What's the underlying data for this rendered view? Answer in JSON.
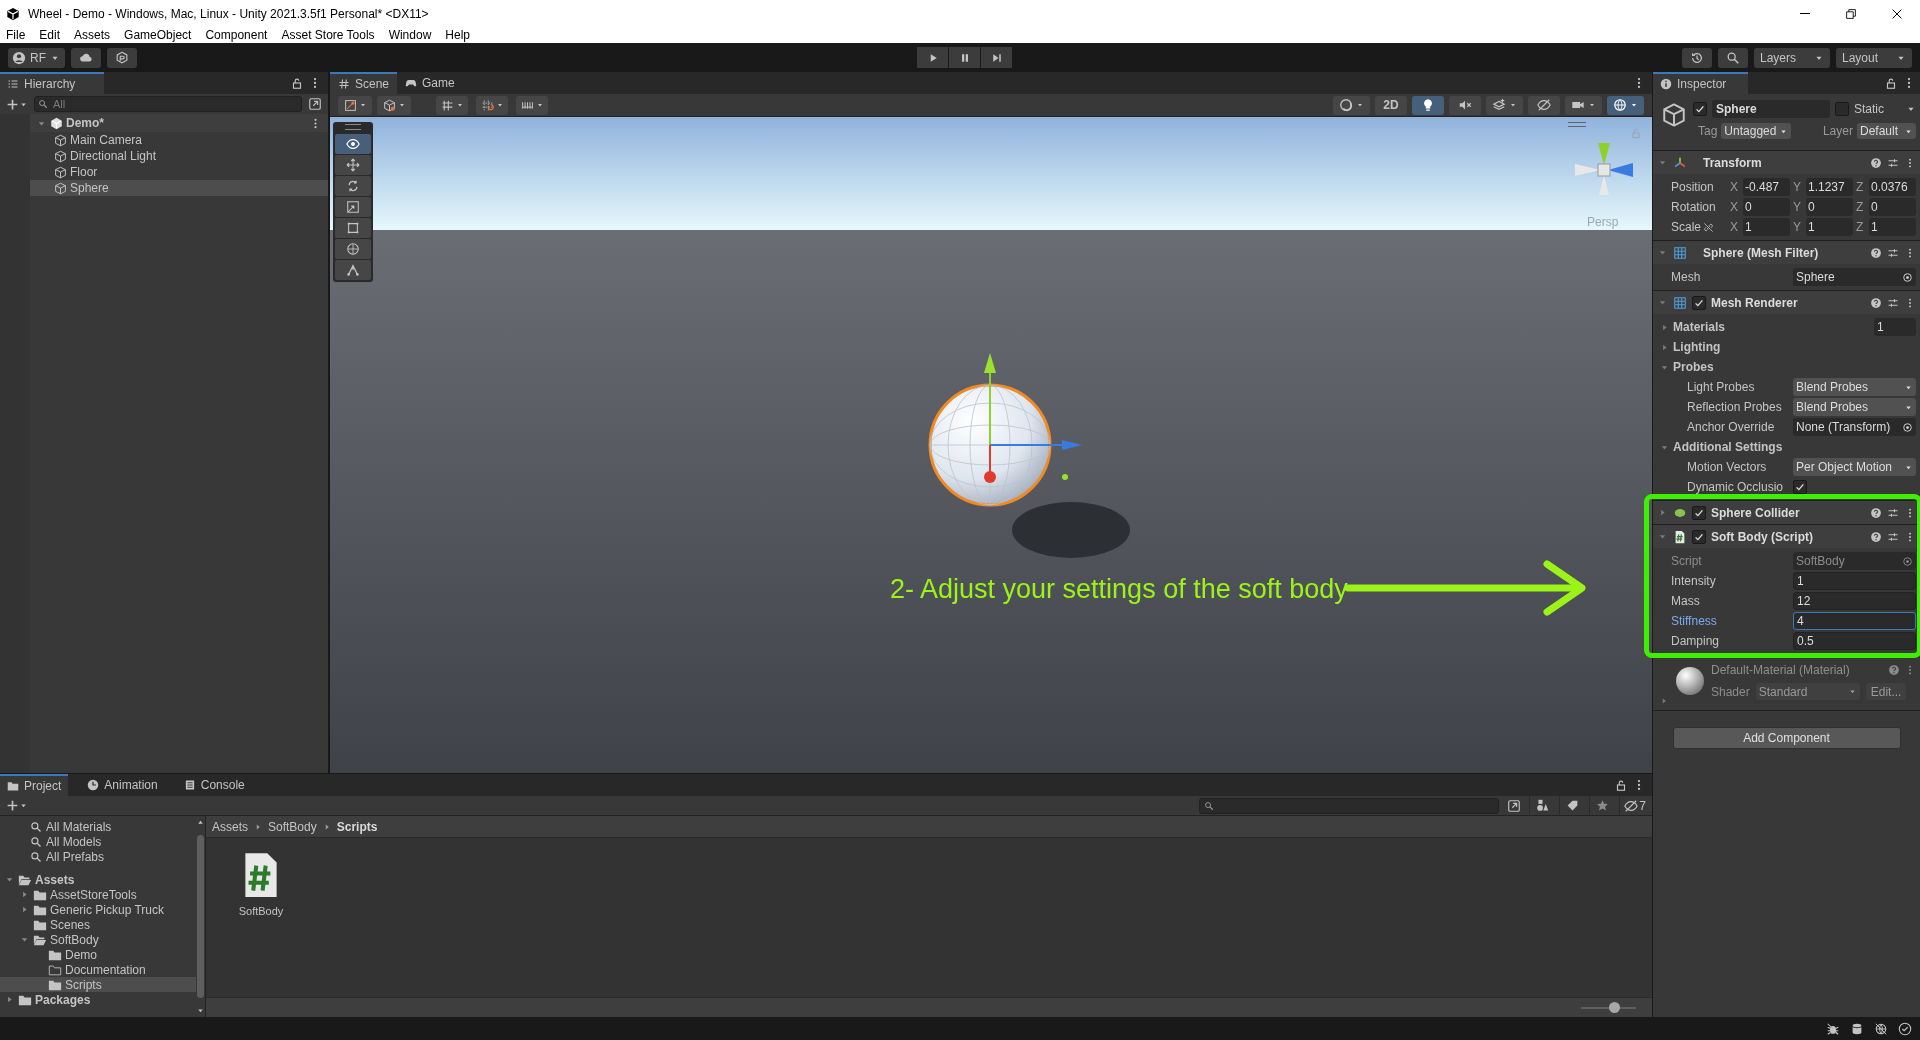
{
  "window": {
    "title": "Wheel - Demo - Windows, Mac, Linux - Unity 2021.3.5f1 Personal* <DX11>"
  },
  "menu": [
    "File",
    "Edit",
    "Assets",
    "GameObject",
    "Component",
    "Asset Store Tools",
    "Window",
    "Help"
  ],
  "toolbar": {
    "account": "RF",
    "layers": "Layers",
    "layout": "Layout"
  },
  "hierarchy": {
    "title": "Hierarchy",
    "search_placeholder": "All",
    "scene": {
      "name": "Demo*",
      "expanded": true,
      "children": [
        {
          "name": "Main Camera",
          "selected": false
        },
        {
          "name": "Directional Light",
          "selected": false
        },
        {
          "name": "Floor",
          "selected": false
        },
        {
          "name": "Sphere",
          "selected": true
        }
      ]
    }
  },
  "scene_view": {
    "tabs": [
      {
        "label": "Scene",
        "kind": "scene",
        "selected": true
      },
      {
        "label": "Game",
        "kind": "game",
        "selected": false
      }
    ],
    "tools": [
      {
        "kind": "view",
        "selected": true
      },
      {
        "kind": "move",
        "selected": false
      },
      {
        "kind": "rotate",
        "selected": false
      },
      {
        "kind": "scale",
        "selected": false
      },
      {
        "kind": "rect",
        "selected": false
      },
      {
        "kind": "transform",
        "selected": false
      },
      {
        "kind": "custom",
        "selected": false
      }
    ],
    "toggles": [
      {
        "kind": "shading",
        "on": false
      },
      {
        "kind": "mode2d",
        "label": "2D",
        "on": false
      },
      {
        "kind": "light",
        "on": true
      },
      {
        "kind": "audio",
        "on": false
      },
      {
        "kind": "fx",
        "on": false
      },
      {
        "kind": "visibility",
        "on": false
      },
      {
        "kind": "camera",
        "on": false
      },
      {
        "kind": "gizmos",
        "on": true
      }
    ],
    "gizmo_label": "Persp",
    "annotation": "2- Adjust your settings of the soft body"
  },
  "inspector": {
    "title": "Inspector",
    "object": {
      "active": true,
      "name": "Sphere",
      "static": false,
      "static_label": "Static",
      "tag_label": "Tag",
      "tag": "Untagged",
      "layer_label": "Layer",
      "layer": "Default"
    },
    "components": [
      {
        "kind": "transform",
        "title": "Transform",
        "expanded": true,
        "rows": [
          {
            "label": "Position",
            "kind": "vector",
            "values": [
              {
                "axis": "X",
                "value": "-0.487"
              },
              {
                "axis": "Y",
                "value": "1.1237"
              },
              {
                "axis": "Z",
                "value": "0.0376"
              }
            ]
          },
          {
            "label": "Rotation",
            "kind": "vector",
            "values": [
              {
                "axis": "X",
                "value": "0"
              },
              {
                "axis": "Y",
                "value": "0"
              },
              {
                "axis": "Z",
                "value": "0"
              }
            ]
          },
          {
            "label": "Scale",
            "kind": "vector_link",
            "values": [
              {
                "axis": "X",
                "value": "1"
              },
              {
                "axis": "Y",
                "value": "1"
              },
              {
                "axis": "Z",
                "value": "1"
              }
            ]
          }
        ]
      },
      {
        "kind": "mesh_filter",
        "title": "Sphere (Mesh Filter)",
        "expanded": true,
        "fields": [
          {
            "kind": "object",
            "label": "Mesh",
            "value": "Sphere"
          }
        ]
      },
      {
        "kind": "mesh_renderer",
        "title": "Mesh Renderer",
        "enabled": true,
        "expanded": true,
        "fields": [
          {
            "kind": "foldout",
            "label": "Materials",
            "expanded": false,
            "value": "1"
          },
          {
            "kind": "foldout",
            "label": "Lighting",
            "expanded": false
          },
          {
            "kind": "foldout",
            "label": "Probes",
            "expanded": true,
            "children": [
              {
                "kind": "dropdown",
                "label": "Light Probes",
                "value": "Blend Probes"
              },
              {
                "kind": "dropdown",
                "label": "Reflection Probes",
                "value": "Blend Probes"
              },
              {
                "kind": "object",
                "label": "Anchor Override",
                "value": "None (Transform)"
              }
            ]
          },
          {
            "kind": "foldout",
            "label": "Additional Settings",
            "expanded": true,
            "children": [
              {
                "kind": "dropdown",
                "label": "Motion Vectors",
                "value": "Per Object Motion"
              },
              {
                "kind": "toggle",
                "label": "Dynamic Occlusio",
                "checked": true
              }
            ]
          }
        ]
      },
      {
        "kind": "sphere_collider",
        "title": "Sphere Collider",
        "enabled": true,
        "expanded": false
      },
      {
        "kind": "script",
        "title": "Soft Body (Script)",
        "enabled": true,
        "expanded": true,
        "fields": [
          {
            "kind": "object",
            "label": "Script",
            "value": "SoftBody",
            "disabled": true
          },
          {
            "kind": "number",
            "label": "Intensity",
            "value": "1",
            "focused": false
          },
          {
            "kind": "number",
            "label": "Mass",
            "value": "12",
            "focused": false
          },
          {
            "kind": "number",
            "label": "Stiffness",
            "value": "4",
            "focused": true
          },
          {
            "kind": "number",
            "label": "Damping",
            "value": "0.5",
            "focused": false
          }
        ]
      },
      {
        "kind": "material",
        "title": "Default-Material (Material)",
        "expanded": false,
        "shader_label": "Shader",
        "shader": "Standard",
        "edit": "Edit..."
      }
    ],
    "add_component": "Add Component"
  },
  "project": {
    "tabs": [
      {
        "label": "Project",
        "kind": "project",
        "selected": true
      },
      {
        "label": "Animation",
        "kind": "animation",
        "selected": false
      },
      {
        "label": "Console",
        "kind": "console",
        "selected": false
      }
    ],
    "hidden_count": "7",
    "favorites": [
      "All Materials",
      "All Models",
      "All Prefabs"
    ],
    "tree": [
      {
        "name": "Assets",
        "expanded": true,
        "selected": false,
        "children": [
          {
            "name": "AssetStoreTools",
            "expanded": false,
            "selected": false
          },
          {
            "name": "Generic Pickup Truck",
            "expanded": false,
            "selected": false
          },
          {
            "name": "Scenes",
            "empty": false,
            "selected": false
          },
          {
            "name": "SoftBody",
            "expanded": true,
            "selected": false,
            "children": [
              {
                "name": "Demo",
                "empty": false,
                "selected": false
              },
              {
                "name": "Documentation",
                "empty": true,
                "selected": false
              },
              {
                "name": "Scripts",
                "empty": false,
                "selected": true
              }
            ]
          }
        ]
      },
      {
        "name": "Packages",
        "expanded": false,
        "selected": false
      }
    ],
    "breadcrumb": [
      "Assets",
      "SoftBody",
      "Scripts"
    ],
    "assets": [
      {
        "name": "SoftBody",
        "kind": "script"
      }
    ],
    "zoom_slider": {
      "level": 0.6
    }
  }
}
